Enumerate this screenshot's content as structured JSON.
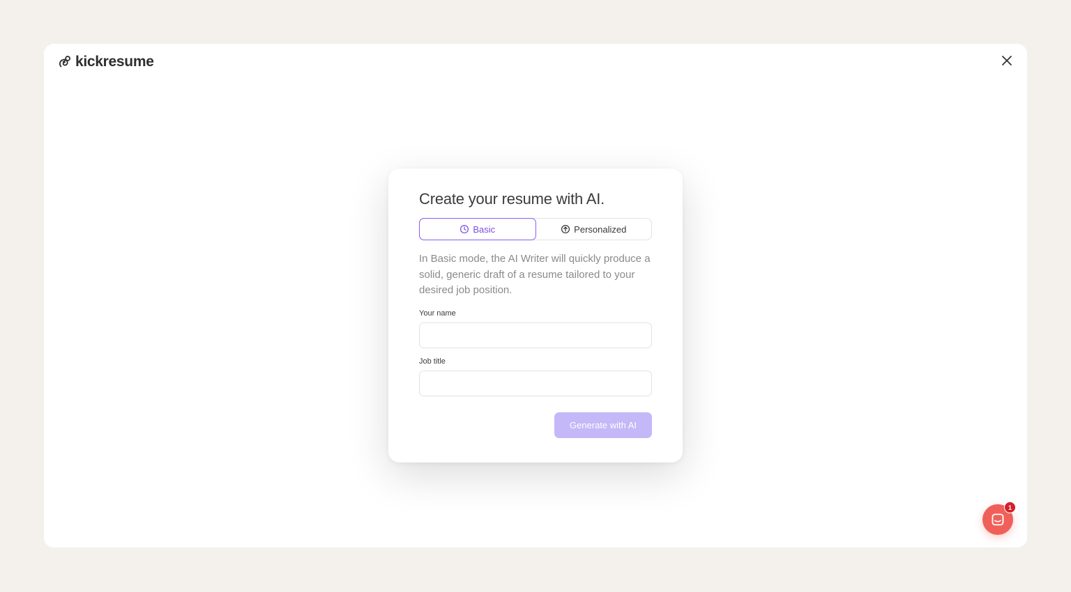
{
  "brand": {
    "name": "kickresume",
    "logo_icon": "kickresume-logo-icon"
  },
  "header": {
    "close_icon": "close-icon"
  },
  "modal": {
    "title": "Create your resume with AI.",
    "tabs": [
      {
        "label": "Basic",
        "icon": "clock-icon",
        "active": true
      },
      {
        "label": "Personalized",
        "icon": "upload-circle-icon",
        "active": false
      }
    ],
    "description": "In Basic mode, the AI Writer will quickly produce a solid, generic draft of a resume tailored to your desired job position.",
    "fields": {
      "name": {
        "label": "Your name",
        "value": "",
        "placeholder": ""
      },
      "job_title": {
        "label": "Job title",
        "value": "",
        "placeholder": ""
      }
    },
    "submit_label": "Generate with AI"
  },
  "chat": {
    "icon": "chat-icon",
    "badge_count": "1"
  },
  "colors": {
    "page_background": "#f4f1ec",
    "accent": "#8b5cf6",
    "button_disabled": "#c4b8f8",
    "chat_launcher": "#f0605a",
    "badge": "#d4202a"
  }
}
